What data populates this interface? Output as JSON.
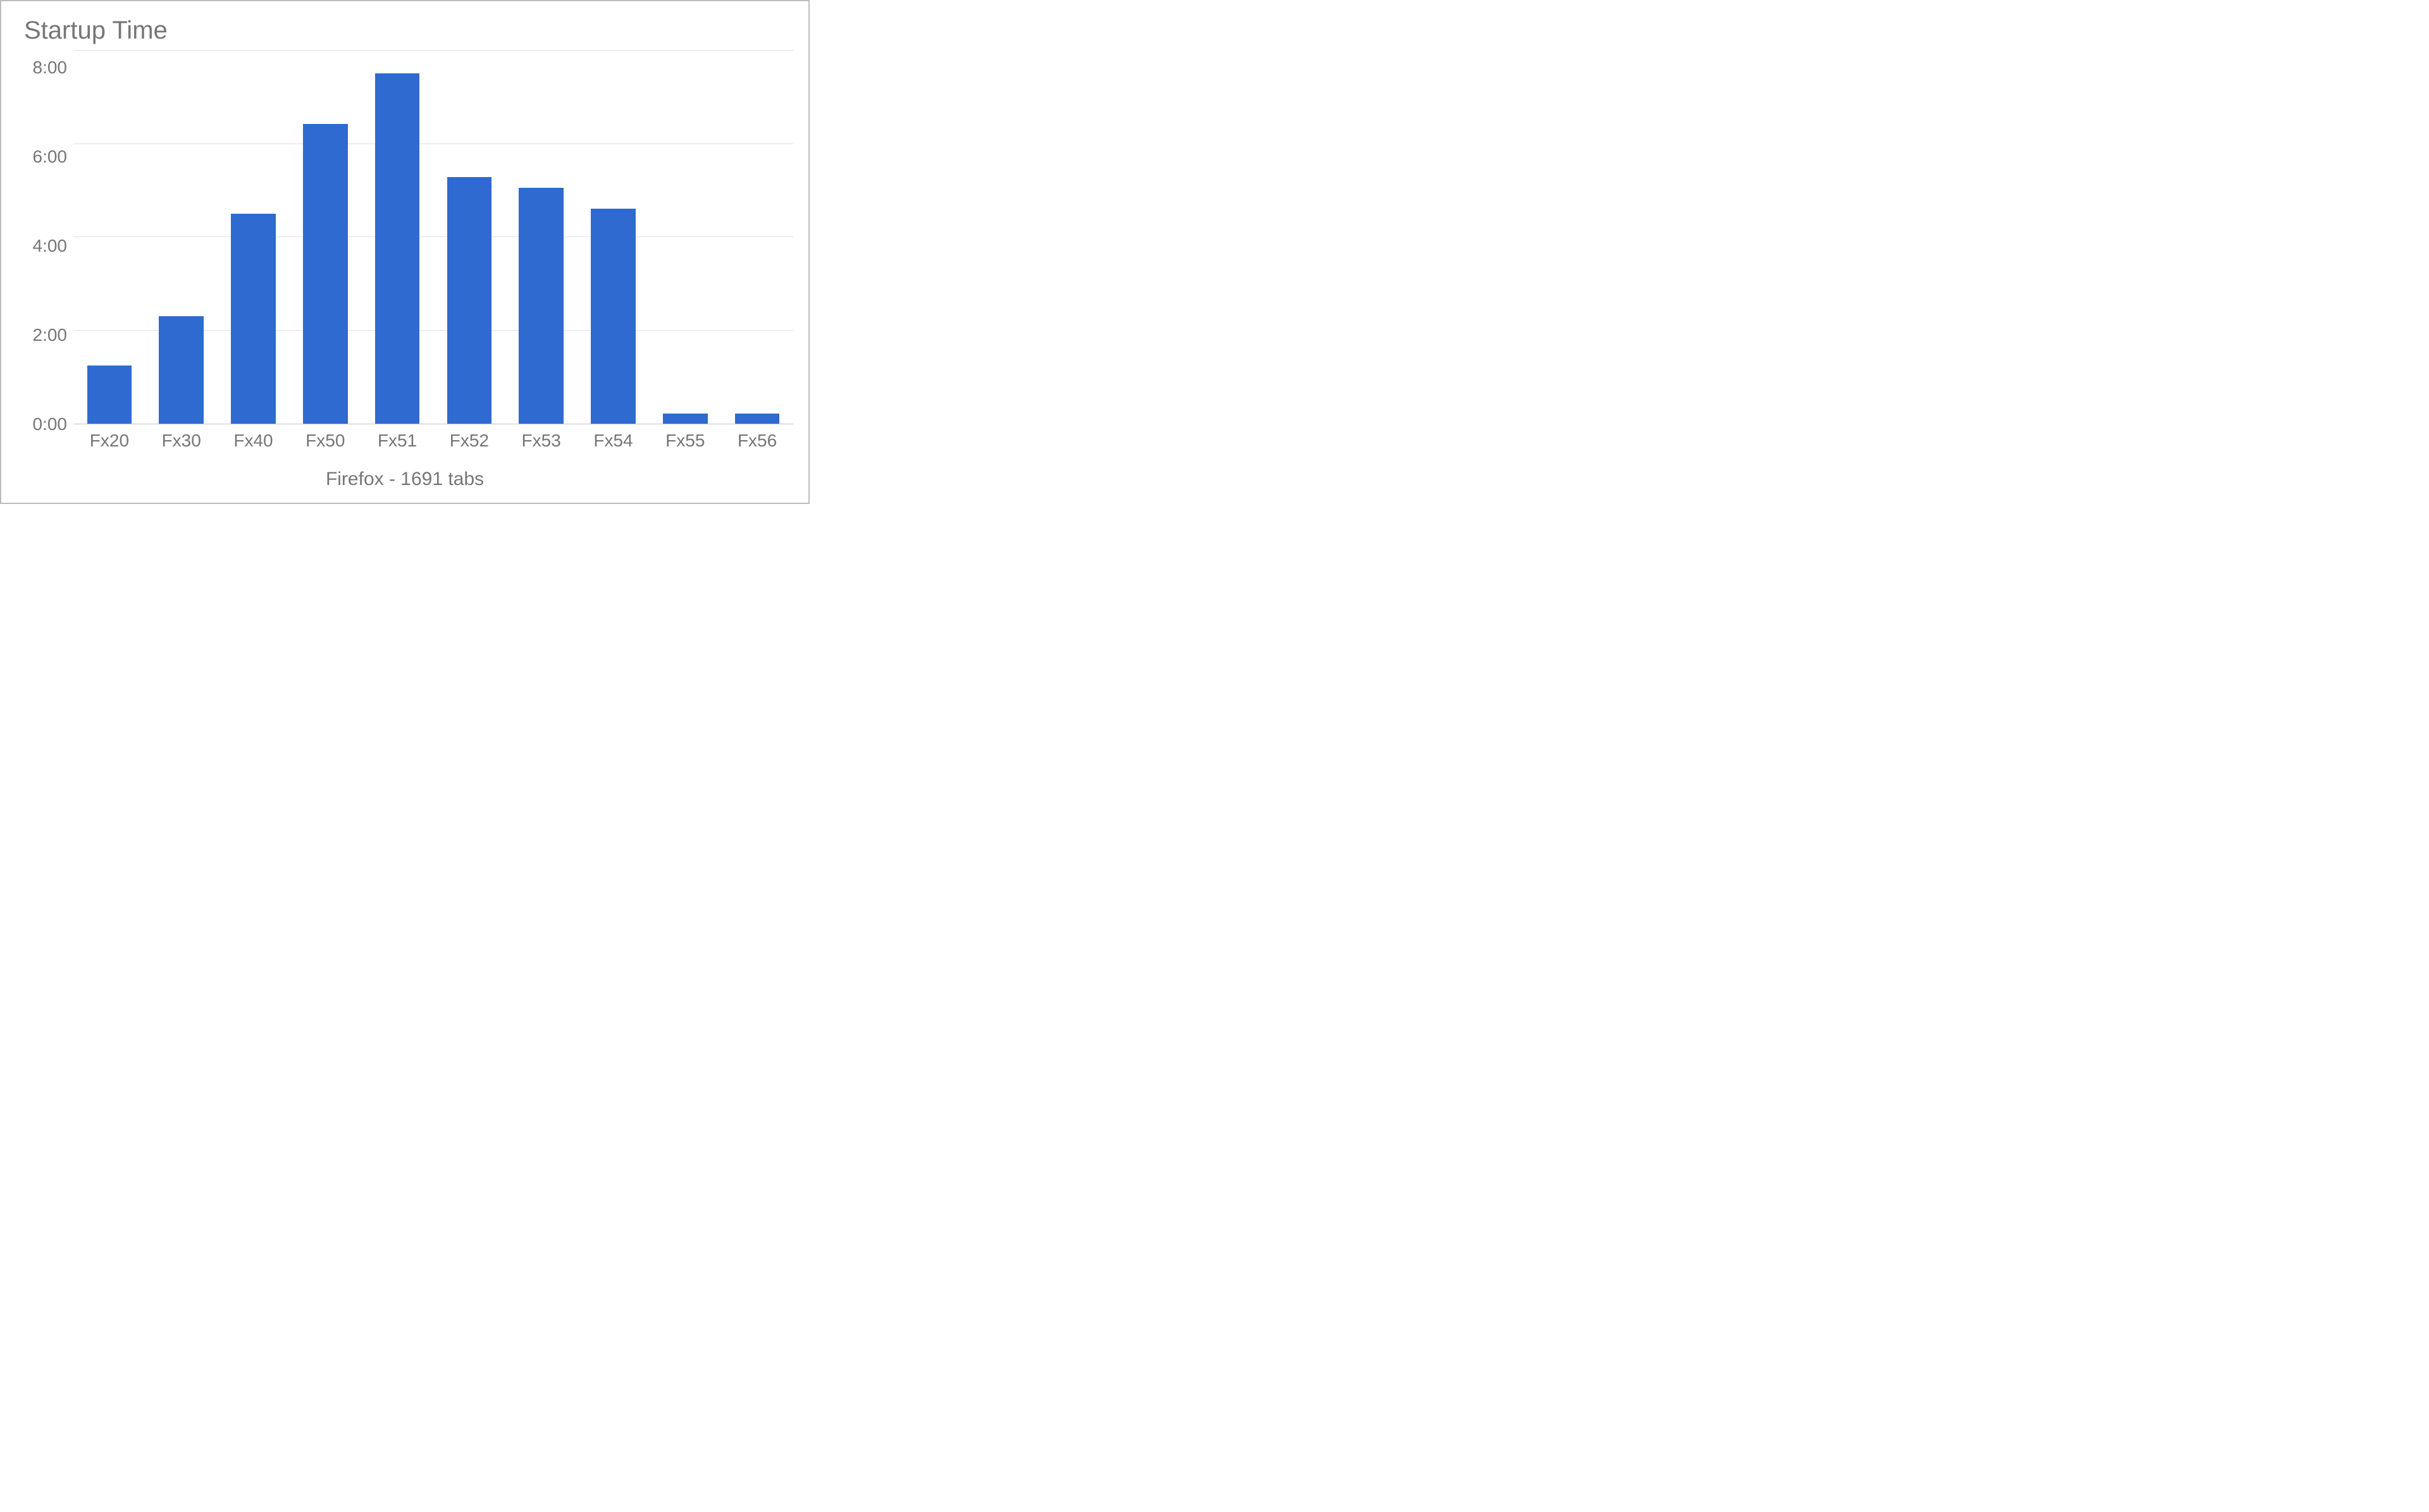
{
  "chart_data": {
    "type": "bar",
    "title": "Startup Time",
    "xlabel": "Firefox - 1691 tabs",
    "ylabel": "",
    "y_ticks": [
      "8:00",
      "6:00",
      "4:00",
      "2:00",
      "0:00"
    ],
    "ylim": [
      0,
      8
    ],
    "categories": [
      "Fx20",
      "Fx30",
      "Fx40",
      "Fx50",
      "Fx51",
      "Fx52",
      "Fx53",
      "Fx54",
      "Fx55",
      "Fx56"
    ],
    "values": [
      1.25,
      2.3,
      4.5,
      6.42,
      7.5,
      5.28,
      5.05,
      4.6,
      0.22,
      0.22
    ],
    "bar_color": "#2f6ad0"
  }
}
